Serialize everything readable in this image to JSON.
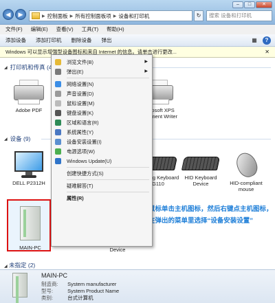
{
  "address": {
    "crumbs": [
      "控制面板",
      "所有控制面板项",
      "设备和打印机"
    ],
    "search_placeholder": "搜索 设备和打印机"
  },
  "menu": [
    "文件(F)",
    "编辑(E)",
    "查看(V)",
    "工具(T)",
    "帮助(H)"
  ],
  "toolbar": {
    "add_device": "添加设备",
    "add_printer": "添加打印机",
    "remove_device": "删除设备",
    "eject": "弹出"
  },
  "infobar": {
    "text": "Windows 可以显示增强型设备图标和来自 Internet 的信息。请单击进行更改..."
  },
  "sections": {
    "printers": "打印机和传真 (4)",
    "devices": "设备 (9)",
    "unspecified": "未指定 (2)"
  },
  "printers": [
    {
      "label": "Adobe PDF"
    },
    {
      "label": ""
    },
    {
      "label": ""
    },
    {
      "label": "Microsoft XPS Document Writer"
    }
  ],
  "devices": [
    {
      "label": "DELL P2312H"
    },
    {
      "label": "Gaming Keyboard G110"
    },
    {
      "label": "HID Keyboard Device"
    },
    {
      "label": "HID-compliant mouse"
    },
    {
      "label": "MAIN-PC"
    },
    {
      "label": "0ENG1E3 SCSI CdRom Device"
    }
  ],
  "context_menu": [
    {
      "label": "浏览文件(B)",
      "submenu": true
    },
    {
      "label": "弹出(E)",
      "submenu": true
    },
    {
      "label": "网络设置(N)"
    },
    {
      "label": "声音设置(D)"
    },
    {
      "label": "鼠标设置(M)"
    },
    {
      "label": "键盘设置(K)"
    },
    {
      "label": "区域和语言(R)"
    },
    {
      "label": "系统属性(Y)"
    },
    {
      "label": "设备安装设置(I)"
    },
    {
      "label": "电源选项(W)"
    },
    {
      "label": "Windows Update(U)"
    },
    {
      "label": "创建快捷方式(S)"
    },
    {
      "label": "疑难解答(T)"
    },
    {
      "label": "属性(R)"
    }
  ],
  "annotation": "鼠标单击主机图标，然后右键点主机图标，在弹出的菜单里选择“设备安装设置”",
  "details": {
    "name": "MAIN-PC",
    "manufacturer_label": "制造商:",
    "manufacturer": "System manufacturer",
    "model_label": "型号:",
    "model": "System Product Name",
    "category_label": "类别:",
    "category": "台式计算机"
  },
  "colors": {
    "highlight_red": "#dd1111",
    "annotation_blue": "#1f7fd8"
  }
}
